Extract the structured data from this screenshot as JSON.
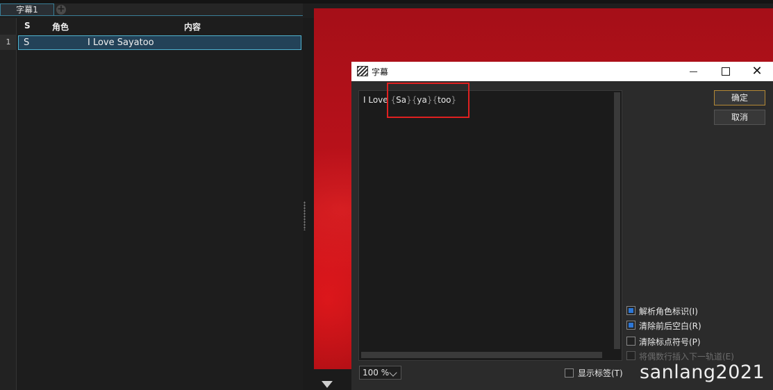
{
  "tabs": [
    {
      "label": "字幕1"
    }
  ],
  "add_tab_icon": "plus-circle-icon",
  "grid": {
    "columns": {
      "s": "S",
      "role": "角色",
      "content": "内容"
    },
    "rows": [
      {
        "num": "1",
        "s": "S",
        "role": "",
        "content": "I Love Sayatoo"
      }
    ]
  },
  "dialog": {
    "title": "字幕",
    "icon": "clapperboard-icon",
    "editor": {
      "plain": "I Love ",
      "tokens": [
        {
          "open": "{",
          "text": "Sa",
          "close": "}"
        },
        {
          "open": "{",
          "text": "ya",
          "close": "}"
        },
        {
          "open": "{",
          "text": "too",
          "close": "}"
        }
      ]
    },
    "ok_label": "确定",
    "cancel_label": "取消",
    "options": [
      {
        "label": "解析角色标识(I)",
        "checked": true,
        "enabled": true
      },
      {
        "label": "清除前后空白(R)",
        "checked": true,
        "enabled": true
      },
      {
        "label": "清除标点符号(P)",
        "checked": false,
        "enabled": true
      },
      {
        "label": "将偶数行插入下一轨道(E)",
        "checked": false,
        "enabled": false
      }
    ],
    "zoom_value": "100 %",
    "show_tags_label": "显示标签(T)",
    "show_tags_checked": false
  },
  "watermark": "sanlang2021",
  "colors": {
    "accent": "#4fb3d0",
    "selected_row": "#234258",
    "preview_red": "#b8111a",
    "highlight_box": "#e02020"
  }
}
